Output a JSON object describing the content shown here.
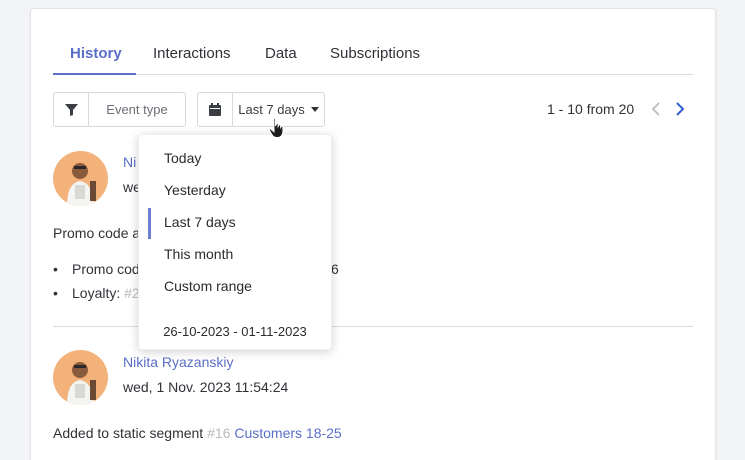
{
  "tabs": [
    {
      "label": "History",
      "active": true
    },
    {
      "label": "Interactions",
      "active": false
    },
    {
      "label": "Data",
      "active": false
    },
    {
      "label": "Subscriptions",
      "active": false
    }
  ],
  "filters": {
    "event_type_label": "Event type",
    "date_label": "Last 7 days"
  },
  "pager": {
    "text": "1 - 10 from 20"
  },
  "entries": [
    {
      "name": "Ni",
      "date": "we",
      "text": "Promo code a",
      "bullets": [
        {
          "label": "Promo cod",
          "tail": "6"
        },
        {
          "label": "Loyalty:",
          "tag": "#2"
        }
      ]
    },
    {
      "name": "Nikita Ryazanskiy",
      "date": "wed, 1 Nov. 2023 11:54:24",
      "text": "Added to static segment",
      "tag": "#16",
      "link": "Customers 18-25"
    }
  ],
  "dropdown": {
    "items": [
      "Today",
      "Yesterday",
      "Last 7 days",
      "This month",
      "Custom range"
    ],
    "selected": "Last 7 days",
    "range": "26-10-2023 - 01-11-2023"
  },
  "colors": {
    "accent": "#5a6fc7",
    "muted": "#b6b9bf"
  }
}
